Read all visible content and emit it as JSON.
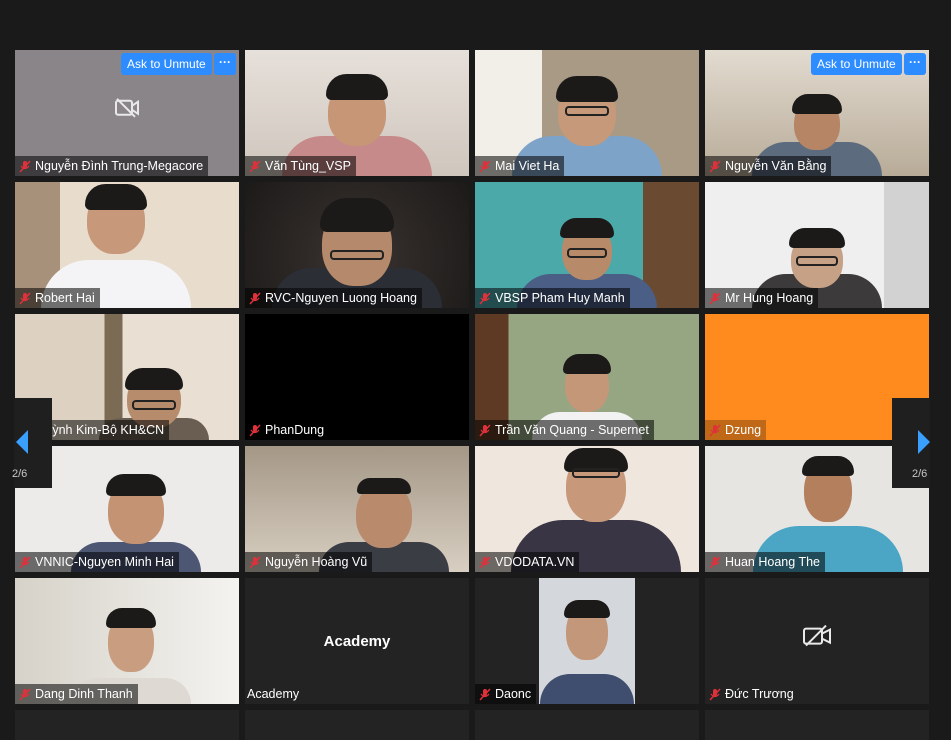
{
  "controls": {
    "ask_to_unmute": "Ask to Unmute",
    "more": "···"
  },
  "pagination": {
    "left_label": "2/6",
    "right_label": "2/6"
  },
  "participants": [
    {
      "name": "Nguyễn Đình Trung-Megacore"
    },
    {
      "name": "Văn Tùng_VSP"
    },
    {
      "name": "Mai Viet Ha"
    },
    {
      "name": "Nguyễn Văn Bằng"
    },
    {
      "name": "Robert Hai"
    },
    {
      "name": "RVC-Nguyen Luong Hoang"
    },
    {
      "name": "VBSP Pham Huy Manh"
    },
    {
      "name": "Mr Hung Hoang"
    },
    {
      "name": "ng Huỳnh Kim-Bộ KH&CN"
    },
    {
      "name": "PhanDung"
    },
    {
      "name": "Trần Văn Quang - Supernet"
    },
    {
      "name": "Dzung"
    },
    {
      "name": "VNNIC-Nguyen Minh Hai"
    },
    {
      "name": "Nguyễn Hoàng Vũ"
    },
    {
      "name": "VDODATA.VN"
    },
    {
      "name": "Huan Hoang The"
    },
    {
      "name": "Dang  Dinh Thanh"
    },
    {
      "name": "Academy",
      "center_label": "Academy"
    },
    {
      "name": "Daonc"
    },
    {
      "name": "Đức Trương"
    }
  ],
  "colors": {
    "background": "#1a1a1a",
    "accent_blue": "#2d8cff",
    "muted_red": "#e0313b",
    "dzung_orange": "#ff8b1f"
  },
  "icons": {
    "mic_muted": "mic-muted-icon",
    "camera_off": "camera-off-icon",
    "prev": "chevron-left-icon",
    "next": "chevron-right-icon"
  }
}
